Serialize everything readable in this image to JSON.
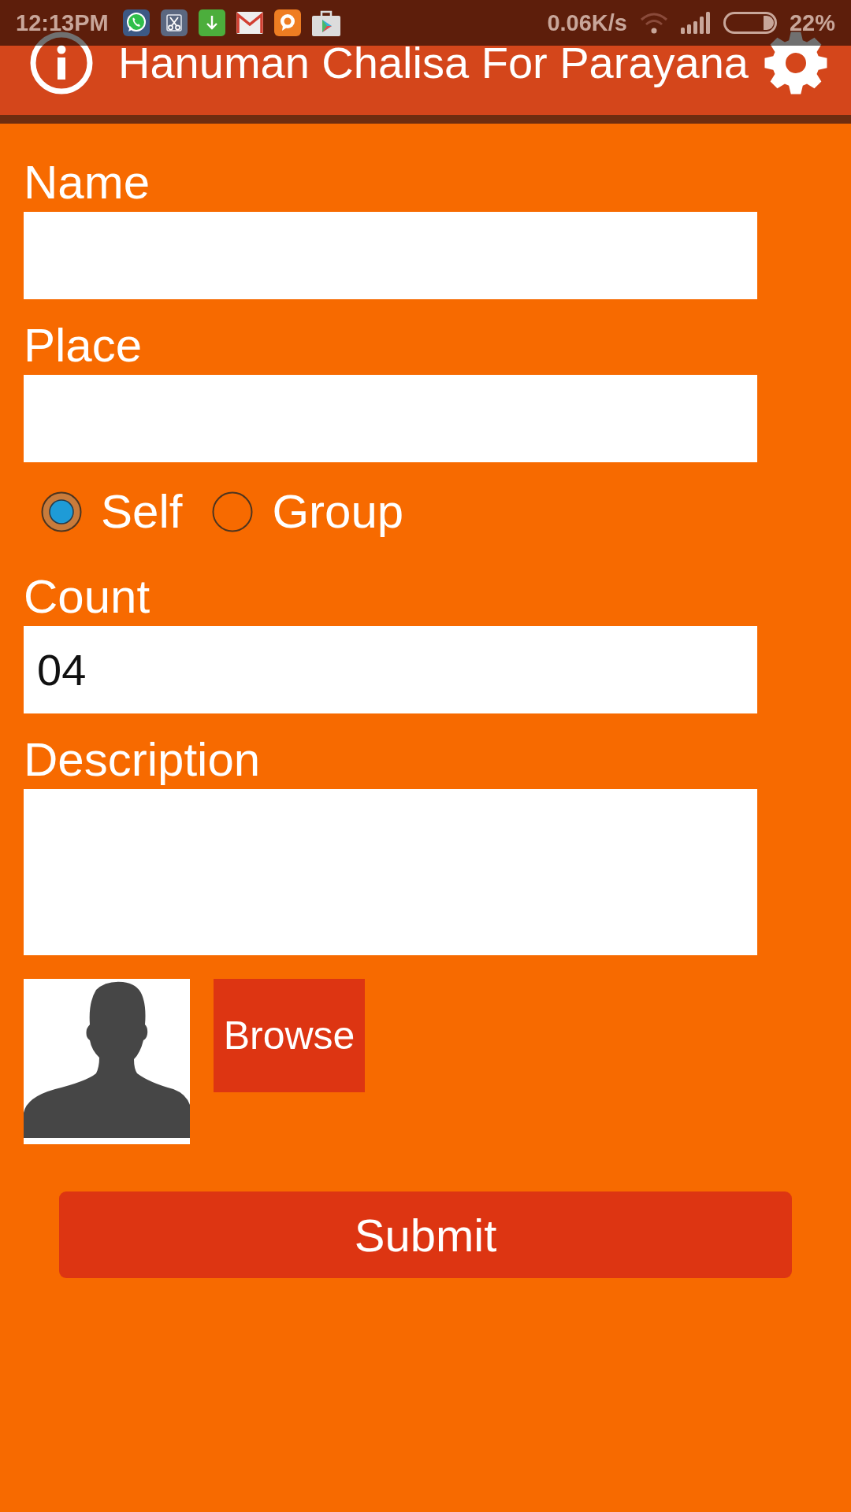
{
  "status_bar": {
    "time": "12:13PM",
    "network_speed": "0.06K/s",
    "battery": "22%"
  },
  "app_bar": {
    "title": "Hanuman Chalisa For Parayana"
  },
  "form": [
    {
      "kind": "text",
      "label": "Name"
    },
    {
      "kind": "text",
      "label": "Place"
    },
    {
      "kind": "radio_group",
      "options": [
        {
          "label": "Self",
          "selected": true
        },
        {
          "label": "Group",
          "selected": false
        }
      ]
    },
    {
      "kind": "text",
      "label": "Count",
      "value": "04"
    },
    {
      "kind": "multiline",
      "label": "Description"
    }
  ],
  "photo_picker": {
    "browse_button": "Browse"
  },
  "submit_button": "Submit"
}
